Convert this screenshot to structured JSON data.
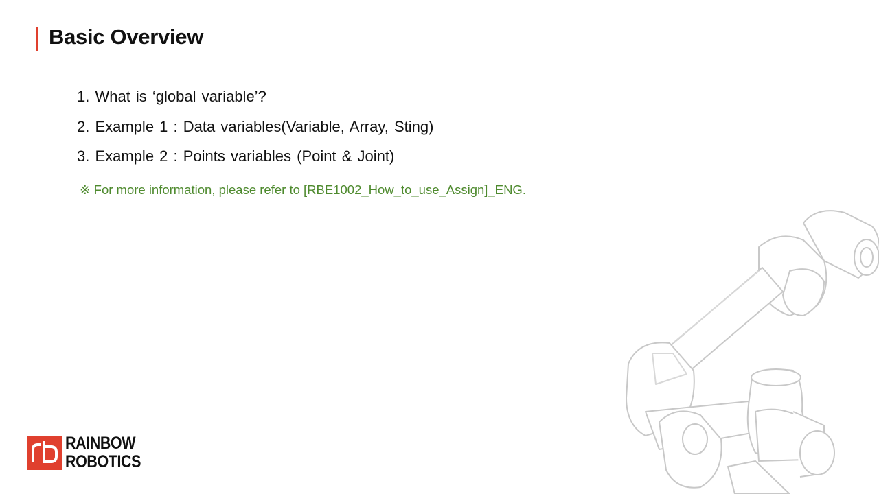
{
  "slide": {
    "title": "Basic Overview",
    "items": [
      "1. What is ‘global variable’?",
      "2. Example 1 : Data variables(Variable,  Array, Sting)",
      "3. Example 2 : Points variables (Point & Joint)"
    ],
    "note": "※ For more information, please refer to [RBE1002_How_to_use_Assign]_ENG."
  },
  "logo": {
    "line1": "RAINBOW",
    "line2": "ROBOTICS",
    "mark_color": "#e0402e"
  },
  "colors": {
    "accent": "#e0402e",
    "note": "#4e8a2e",
    "text": "#111111"
  }
}
